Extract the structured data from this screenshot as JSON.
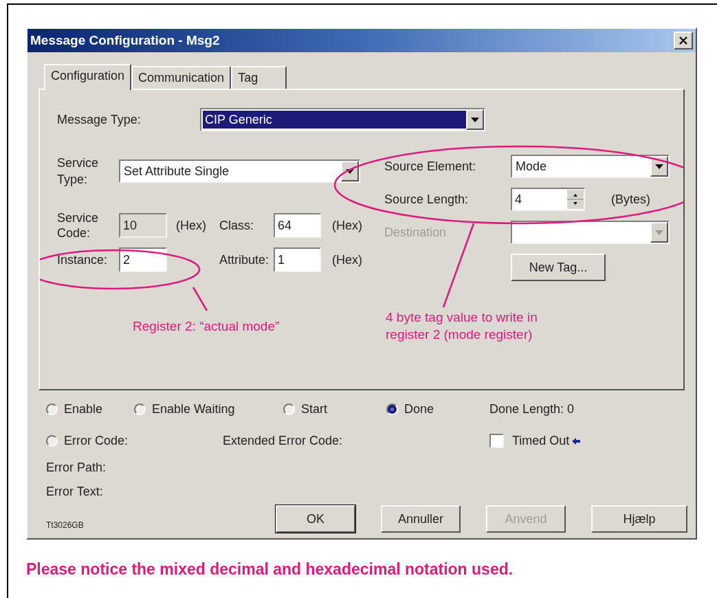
{
  "window": {
    "title": "Message Configuration - Msg2"
  },
  "tabs": [
    {
      "label": "Configuration",
      "selected": true
    },
    {
      "label": "Communication",
      "selected": false
    },
    {
      "label": "Tag",
      "selected": false
    }
  ],
  "message_type": {
    "label": "Message Type:",
    "value": "CIP Generic"
  },
  "service_type": {
    "label": "Service Type:",
    "value": "Set Attribute Single"
  },
  "service_code": {
    "label": "Service Code:",
    "value": "10",
    "unit": "(Hex)",
    "disabled": true
  },
  "class": {
    "label": "Class:",
    "value": "64",
    "unit": "(Hex)"
  },
  "instance": {
    "label": "Instance:",
    "value": "2"
  },
  "attribute": {
    "label": "Attribute:",
    "value": "1",
    "unit": "(Hex)"
  },
  "source_element": {
    "label": "Source Element:",
    "value": "Mode"
  },
  "source_length": {
    "label": "Source Length:",
    "value": "4",
    "unit": "(Bytes)"
  },
  "destination": {
    "label": "Destination",
    "disabled": true
  },
  "new_tag_button": "New Tag...",
  "annotations": [
    {
      "text": "Register 2: “actual mode”"
    },
    {
      "text": "4 byte tag value to write in register 2 (mode register)"
    }
  ],
  "status_radios": [
    {
      "label": "Enable",
      "selected": false
    },
    {
      "label": "Enable Waiting",
      "selected": false
    },
    {
      "label": "Start",
      "selected": false
    },
    {
      "label": "Done",
      "selected": true
    }
  ],
  "done_length": {
    "label": "Done Length:",
    "value": "0"
  },
  "error_code": {
    "label": "Error Code:",
    "selected": false
  },
  "extended_error_code": "Extended Error Code:",
  "timed_out": {
    "label": "Timed Out",
    "checked": false
  },
  "error_path": "Error Path:",
  "error_text": "Error Text:",
  "buttons": [
    {
      "label": "OK",
      "default": true,
      "disabled": false
    },
    {
      "label": "Annuller",
      "default": false,
      "disabled": false
    },
    {
      "label": "Anvend",
      "default": false,
      "disabled": true
    },
    {
      "label": "Hjælp",
      "default": false,
      "disabled": false
    }
  ],
  "figure_id": "Tt3026GB",
  "caption": "Please notice the mixed decimal and hexadecimal notation used."
}
